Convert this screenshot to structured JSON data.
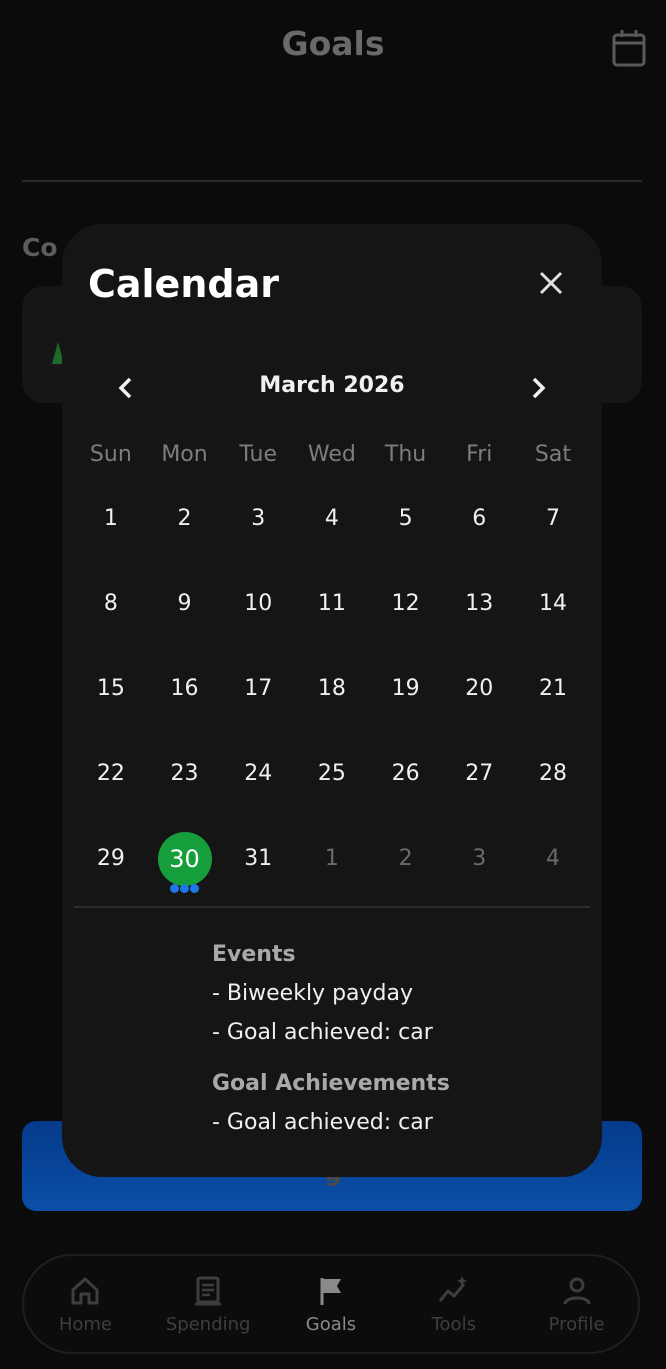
{
  "header": {
    "title": "Goals"
  },
  "background": {
    "section_label": "Co",
    "button_label": "g"
  },
  "calendar": {
    "title": "Calendar",
    "month_label": "March 2026",
    "weekdays": [
      "Sun",
      "Mon",
      "Tue",
      "Wed",
      "Thu",
      "Fri",
      "Sat"
    ],
    "weeks": [
      [
        "1",
        "2",
        "3",
        "4",
        "5",
        "6",
        "7"
      ],
      [
        "8",
        "9",
        "10",
        "11",
        "12",
        "13",
        "14"
      ],
      [
        "15",
        "16",
        "17",
        "18",
        "19",
        "20",
        "21"
      ],
      [
        "22",
        "23",
        "24",
        "25",
        "26",
        "27",
        "28"
      ],
      [
        "29",
        "30",
        "31",
        "1",
        "2",
        "3",
        "4"
      ]
    ],
    "selected_day": "30",
    "selected_color": "#169e3d",
    "event_dot_color": "#1d77e6",
    "events_heading": "Events",
    "events": [
      "- Biweekly payday",
      "- Goal achieved: car"
    ],
    "achievements_heading": "Goal Achievements",
    "achievements": [
      "- Goal achieved: car"
    ]
  },
  "nav": {
    "items": [
      {
        "label": "Home",
        "icon": "home-icon"
      },
      {
        "label": "Spending",
        "icon": "receipt-icon"
      },
      {
        "label": "Goals",
        "icon": "flag-icon"
      },
      {
        "label": "Tools",
        "icon": "sparkle-chart-icon"
      },
      {
        "label": "Profile",
        "icon": "person-icon"
      }
    ],
    "active": "Goals"
  }
}
